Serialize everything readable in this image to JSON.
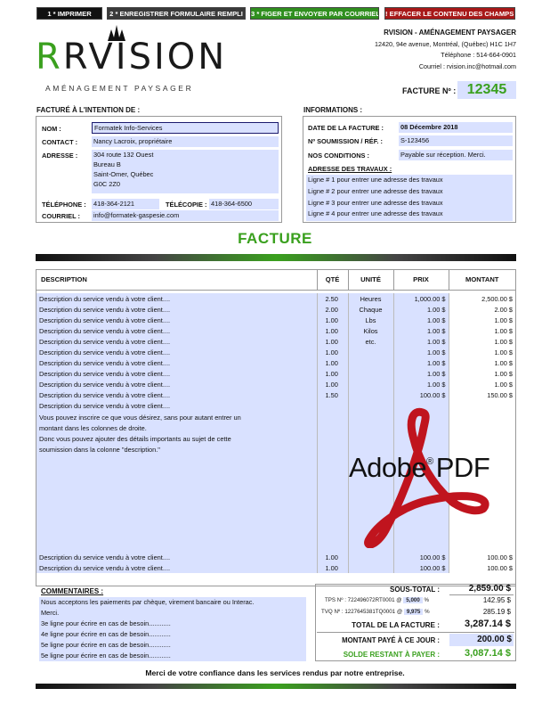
{
  "toolbar": {
    "print": "1 * IMPRIMER",
    "save": "2 * ENREGISTRER FORMULAIRE REMPLI",
    "send": "3 * FIGER ET ENVOYER PAR COURRIEL",
    "clear": "! EFFACER LE CONTENU DES CHAMPS !"
  },
  "logo": {
    "brand": "RVISION",
    "tagline": "AMÉNAGEMENT PAYSAGER"
  },
  "company": {
    "name": "RVISION - AMÉNAGEMENT PAYSAGER",
    "address": "12420, 94e avenue, Montréal, (Québec) H1C 1H7",
    "phone": "Téléphone  :  514-664-0901",
    "email": "Courriel  :  rvision.inc@hotmail.com"
  },
  "invoice": {
    "number_label": "FACTURE Nº :",
    "number": "12345",
    "title": "FACTURE"
  },
  "billto": {
    "heading": "FACTURÉ À L'INTENTION DE :",
    "name_label": "NOM :",
    "name": "Formatek Info-Services",
    "contact_label": "CONTACT :",
    "contact": "Nancy Lacroix, propriétaire",
    "address_label": "ADRESSE :",
    "address": [
      "304 route 132 Ouest",
      "Bureau B",
      "Saint-Omer, Québec",
      "G0C 2Z0"
    ],
    "phone_label": "TÉLÉPHONE :",
    "phone": "418-364-2121",
    "fax_label": "TÉLÉCOPIE :",
    "fax": "418-364-6500",
    "email_label": "COURRIEL :",
    "email": "info@formatek-gaspesie.com"
  },
  "info": {
    "heading": "INFORMATIONS :",
    "date_label": "DATE DE LA FACTURE :",
    "date": "08 Décembre 2018",
    "quote_label": "Nº SOUMISSION / RÉF. :",
    "quote": "S-123456",
    "cond_label": "NOS CONDITIONS :",
    "cond": "Payable sur réception. Merci.",
    "work_label": "ADRESSE DES TRAVAUX :",
    "work": [
      "Ligne # 1 pour entrer une adresse des travaux",
      "Ligne # 2 pour entrer une adresse des travaux",
      "Ligne # 3 pour entrer une adresse des travaux",
      "Ligne # 4 pour entrer une adresse des travaux"
    ]
  },
  "table": {
    "headers": [
      "DESCRIPTION",
      "QTÉ",
      "UNITÉ",
      "PRIX",
      "MONTANT"
    ],
    "rows": [
      [
        "Description du service vendu à votre client....",
        "2.50",
        "Heures",
        "1,000.00 $",
        "2,500.00 $"
      ],
      [
        "Description du service vendu à votre client....",
        "2.00",
        "Chaque",
        "1.00 $",
        "2.00 $"
      ],
      [
        "Description du service vendu à votre client....",
        "1.00",
        "Lbs",
        "1.00 $",
        "1.00 $"
      ],
      [
        "Description du service vendu à votre client....",
        "1.00",
        "Kilos",
        "1.00 $",
        "1.00 $"
      ],
      [
        "Description du service vendu à votre client....",
        "1.00",
        "etc.",
        "1.00 $",
        "1.00 $"
      ],
      [
        "Description du service vendu à votre client....",
        "1.00",
        "",
        "1.00 $",
        "1.00 $"
      ],
      [
        "Description du service vendu à votre client....",
        "1.00",
        "",
        "1.00 $",
        "1.00 $"
      ],
      [
        "Description du service vendu à votre client....",
        "1.00",
        "",
        "1.00 $",
        "1.00 $"
      ],
      [
        "Description du service vendu à votre client....",
        "1.00",
        "",
        "1.00 $",
        "1.00 $"
      ],
      [
        "Description du service vendu à votre client....",
        "1.50",
        "",
        "100.00 $",
        "150.00 $"
      ],
      [
        "Description du service vendu à votre client....",
        "",
        "",
        "",
        ""
      ],
      [
        "Vous pouvez inscrire ce que vous désirez, sans pour autant entrer un",
        "",
        "",
        "",
        ""
      ],
      [
        "montant dans les colonnes de droite.",
        "",
        "",
        "",
        ""
      ],
      [
        "Donc vous pouvez ajouter des détails importants au sujet de cette",
        "",
        "",
        "",
        ""
      ],
      [
        "soumission dans la colonne \"description.\"",
        "",
        "",
        "",
        ""
      ],
      [
        "",
        "",
        "",
        "",
        ""
      ],
      [
        "",
        "",
        "",
        "",
        ""
      ],
      [
        "",
        "",
        "",
        "",
        ""
      ],
      [
        "",
        "",
        "",
        "",
        ""
      ],
      [
        "",
        "",
        "",
        "",
        ""
      ],
      [
        "",
        "",
        "",
        "",
        ""
      ],
      [
        "",
        "",
        "",
        "",
        ""
      ],
      [
        "",
        "",
        "",
        "",
        ""
      ],
      [
        "",
        "",
        "",
        "",
        ""
      ],
      [
        "Description du service vendu à votre client....",
        "1.00",
        "",
        "100.00 $",
        "100.00 $"
      ],
      [
        "Description du service vendu à votre client....",
        "1.00",
        "",
        "100.00 $",
        "100.00 $"
      ]
    ]
  },
  "watermark": {
    "brand": "Adobe",
    "suffix": "PDF",
    "reg": "®"
  },
  "comments": {
    "heading": "COMMENTAIRES :",
    "lines": [
      "Nous acceptons les paiements par chèque, virement bancaire ou Interac.",
      "Merci.",
      "3e ligne pour écrire en cas de besoin............",
      "4e ligne pour écrire en cas de besoin............",
      "5e ligne pour écrire en cas de besoin............",
      "5e ligne pour écrire en cas de besoin............"
    ]
  },
  "totals": {
    "subtotal_label": "SOUS-TOTAL :",
    "subtotal": "2,859.00 $",
    "tps_label": "TPS Nº :",
    "tps_no": "722496072RT0001",
    "tps_rate": "5,000",
    "tps": "142.95 $",
    "tvq_label": "TVQ Nº :",
    "tvq_no": "1227645381TQ0001",
    "tvq_rate": "9,975",
    "tvq": "285.19 $",
    "at": "@",
    "pct": "%",
    "total_label": "TOTAL DE LA FACTURE :",
    "total": "3,287.14 $",
    "paid_label": "MONTANT PAYÉ À CE JOUR :",
    "paid": "200.00 $",
    "due_label": "SOLDE RESTANT À PAYER :",
    "due": "3,087.14 $"
  },
  "footer": {
    "thanks": "Merci de votre confiance dans les services rendus par notre entreprise."
  },
  "colors": {
    "green": "#3aa01e",
    "navy": "#1b1b6e",
    "field": "#d9e1ff",
    "red": "#c0141e"
  }
}
